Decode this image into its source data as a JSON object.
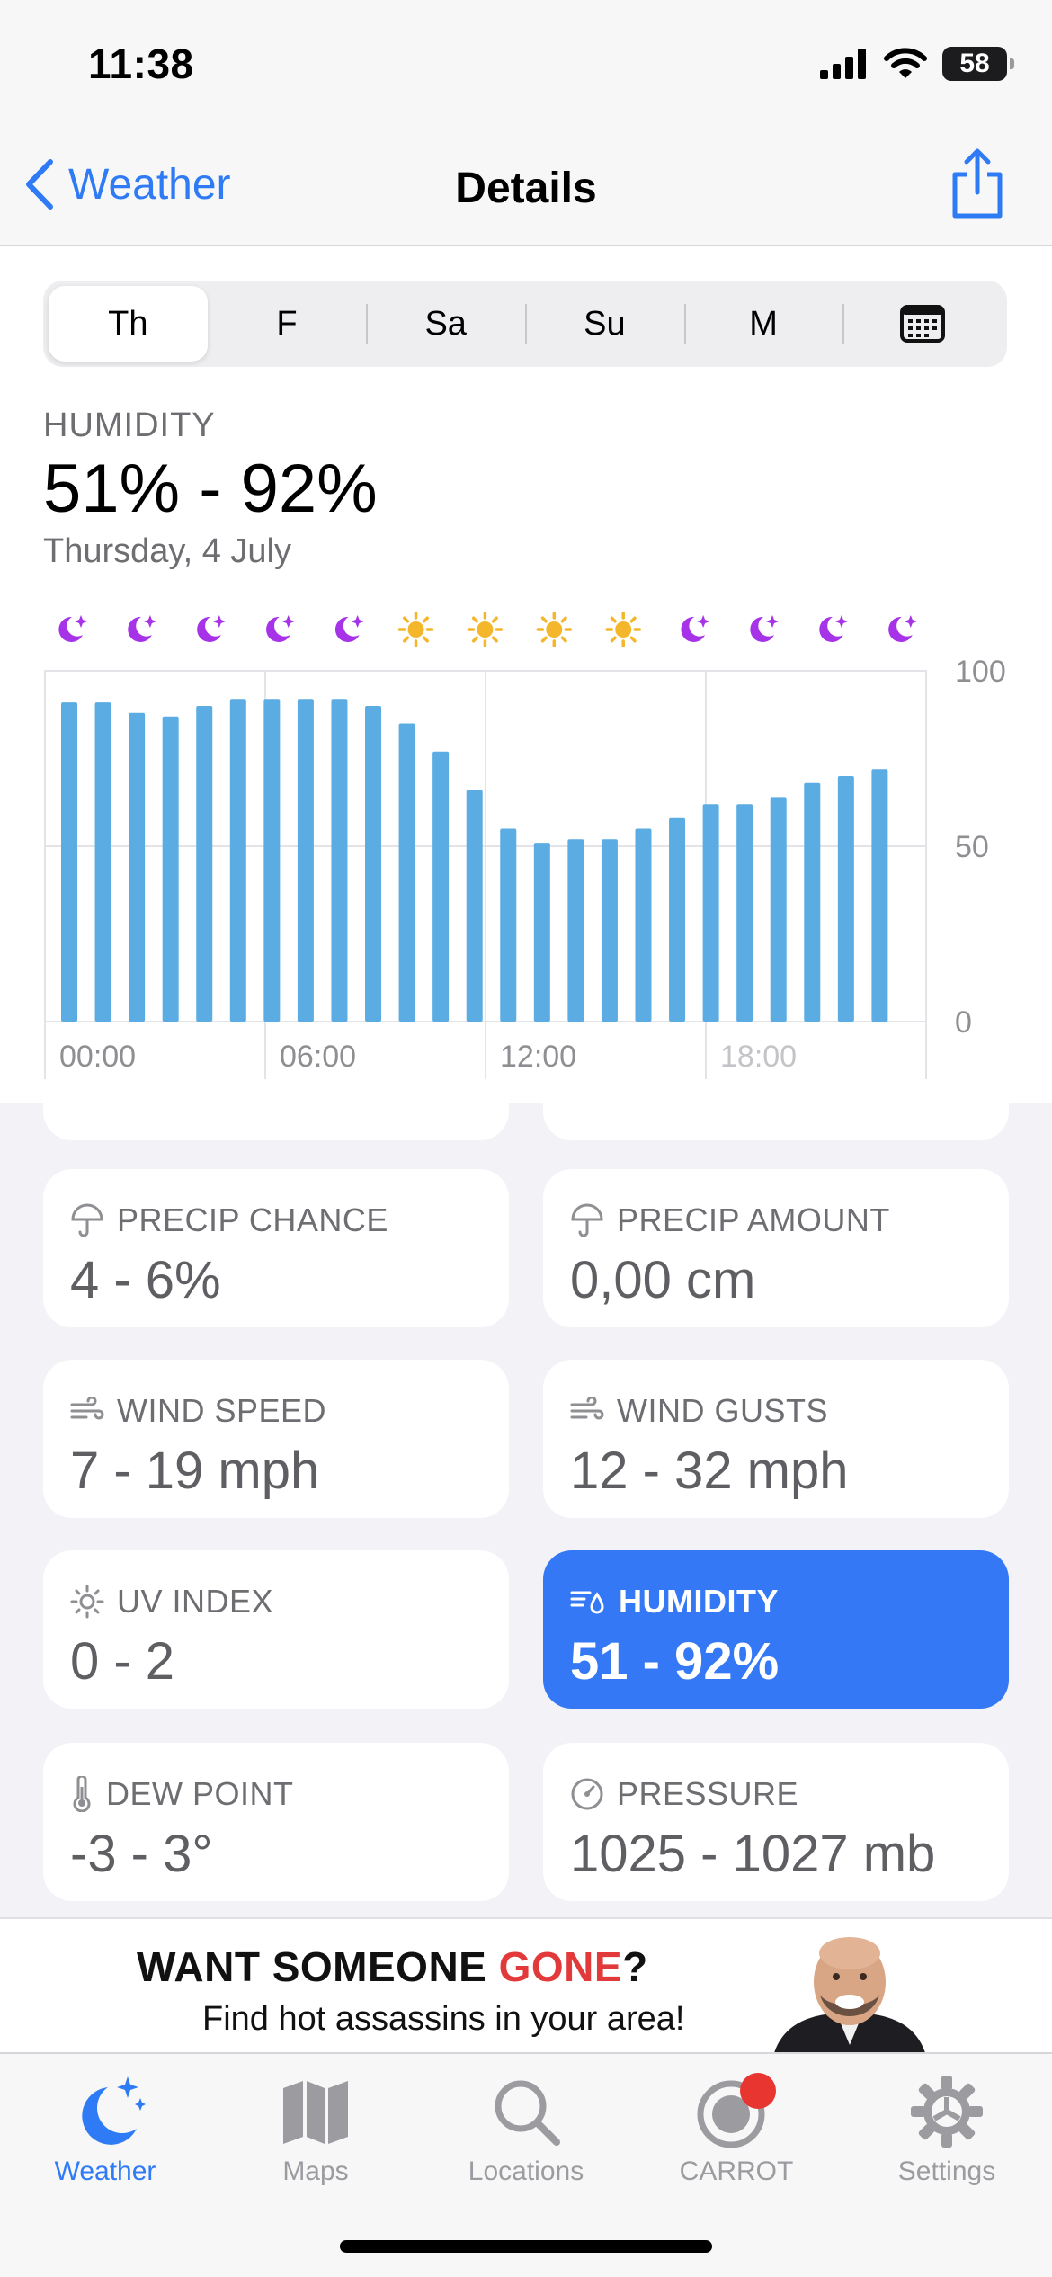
{
  "status_bar": {
    "time": "11:38",
    "battery": "58"
  },
  "nav": {
    "back_label": "Weather",
    "title": "Details"
  },
  "day_tabs": [
    {
      "label": "Th",
      "active": true
    },
    {
      "label": "F"
    },
    {
      "label": "Sa"
    },
    {
      "label": "Su"
    },
    {
      "label": "M"
    },
    {
      "label": "",
      "icon": "calendar-icon"
    }
  ],
  "metric": {
    "label": "HUMIDITY",
    "range": "51% - 92%",
    "date": "Thursday, 4 July"
  },
  "chart_data": {
    "type": "bar",
    "categories": [
      "00:00",
      "01:00",
      "02:00",
      "03:00",
      "04:00",
      "05:00",
      "06:00",
      "07:00",
      "08:00",
      "09:00",
      "10:00",
      "11:00",
      "12:00",
      "13:00",
      "14:00",
      "15:00",
      "16:00",
      "17:00",
      "18:00",
      "19:00",
      "20:00",
      "21:00",
      "22:00",
      "23:00"
    ],
    "values": [
      91,
      91,
      88,
      87,
      90,
      92,
      92,
      92,
      92,
      90,
      85,
      77,
      66,
      55,
      51,
      52,
      52,
      55,
      58,
      62,
      62,
      64,
      68,
      70,
      72
    ],
    "condition_icons": [
      "moon",
      "moon",
      "moon",
      "moon",
      "moon",
      "sun",
      "sun",
      "sun",
      "sun",
      "moon",
      "moon",
      "moon",
      "moon"
    ],
    "x_ticks": [
      "00:00",
      "06:00",
      "12:00",
      "18:00"
    ],
    "y_ticks": [
      "100",
      "50",
      "0"
    ],
    "ylim": [
      0,
      100
    ],
    "grid": true,
    "colors": {
      "bar": "#5aace2",
      "moon": "#a633e8",
      "sun": "#f4b62a"
    }
  },
  "cards": [
    {
      "name": "precip-chance",
      "icon": "umbrella-icon",
      "label": "PRECIP CHANCE",
      "value": "4 - 6%"
    },
    {
      "name": "precip-amount",
      "icon": "umbrella-icon",
      "label": "PRECIP AMOUNT",
      "value": "0,00 cm"
    },
    {
      "name": "wind-speed",
      "icon": "wind-icon",
      "label": "WIND SPEED",
      "value": "7 - 19 mph"
    },
    {
      "name": "wind-gusts",
      "icon": "wind-icon",
      "label": "WIND GUSTS",
      "value": "12 - 32 mph"
    },
    {
      "name": "uv-index",
      "icon": "sun-icon",
      "label": "UV INDEX",
      "value": "0 - 2"
    },
    {
      "name": "humidity",
      "icon": "humidity-icon",
      "label": "HUMIDITY",
      "value": "51 - 92%",
      "selected": true
    },
    {
      "name": "dew-point",
      "icon": "thermometer-icon",
      "label": "DEW POINT",
      "value": "-3 - 3°"
    },
    {
      "name": "pressure",
      "icon": "gauge-icon",
      "label": "PRESSURE",
      "value": "1025 - 1027 mb"
    }
  ],
  "ad": {
    "headline_prefix": "WANT SOMEONE ",
    "headline_accent": "GONE",
    "headline_suffix": "?",
    "subline": "Find hot assassins in your area!"
  },
  "tab_bar": [
    {
      "label": "Weather",
      "icon": "weather-moon-icon",
      "active": true
    },
    {
      "label": "Maps",
      "icon": "map-icon"
    },
    {
      "label": "Locations",
      "icon": "search-icon"
    },
    {
      "label": "CARROT",
      "icon": "carrot-icon"
    },
    {
      "label": "Settings",
      "icon": "gear-icon"
    }
  ],
  "colors": {
    "accent": "#2f7bf5",
    "selected_card": "#3478f6",
    "ad_accent": "#e23a3a",
    "badge": "#e8352f"
  }
}
